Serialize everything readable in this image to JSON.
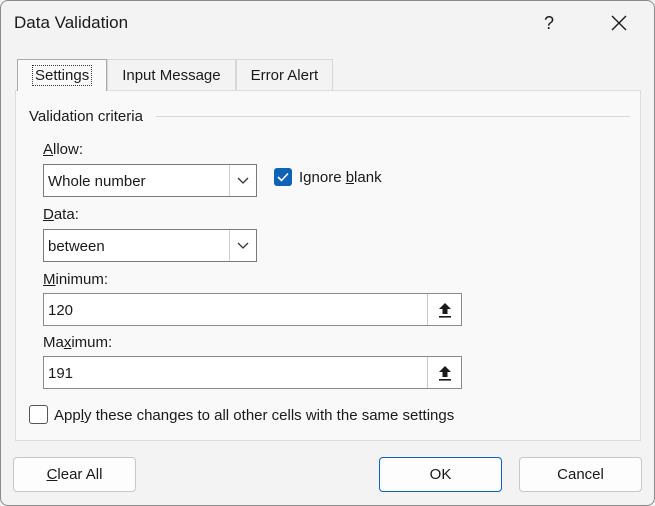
{
  "dialog": {
    "title": "Data Validation",
    "help_label": "?"
  },
  "tabs": [
    {
      "label": "Settings",
      "active": true
    },
    {
      "label": "Input Message",
      "active": false
    },
    {
      "label": "Error Alert",
      "active": false
    }
  ],
  "criteria": {
    "group_title": "Validation criteria",
    "allow": {
      "label_u": "A",
      "label_rest": "llow:",
      "value": "Whole number"
    },
    "ignore_blank": {
      "label_a": "Ignore ",
      "label_u": "b",
      "label_b": "lank",
      "checked": true
    },
    "data": {
      "label_u": "D",
      "label_rest": "ata:",
      "value": "between"
    },
    "minimum": {
      "label_u": "M",
      "label_rest": "inimum:",
      "value": "120"
    },
    "maximum": {
      "label_a": "Ma",
      "label_u": "x",
      "label_b": "imum:",
      "value": "191"
    }
  },
  "apply_all": {
    "label_a": "App",
    "label_u": "l",
    "label_b": "y these changes to all other cells with the same settings",
    "checked": false
  },
  "buttons": {
    "clear_all_u": "C",
    "clear_all_rest": "lear All",
    "ok": "OK",
    "cancel": "Cancel"
  },
  "colors": {
    "accent": "#0f63b6"
  }
}
